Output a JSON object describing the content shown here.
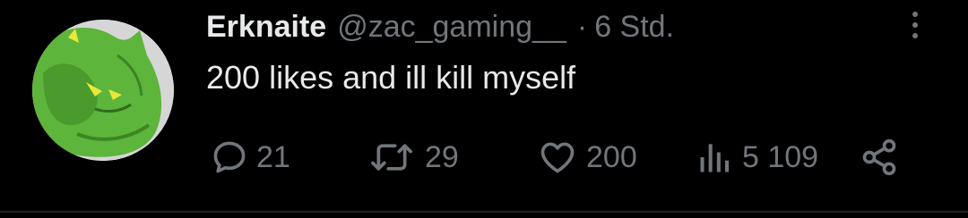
{
  "tweet": {
    "display_name": "Erknaite",
    "handle": "@zac_gaming__",
    "separator": "·",
    "time": "6 Std.",
    "text": "200 likes and ill kill myself"
  },
  "actions": {
    "replies": "21",
    "retweets": "29",
    "likes": "200",
    "views": "5 109"
  },
  "icons": {
    "more": "more-dots-icon",
    "reply": "reply-bubble-icon",
    "retweet": "retweet-icon",
    "like": "heart-icon",
    "views": "views-bar-chart-icon",
    "share": "share-icon"
  },
  "colors": {
    "background": "#000000",
    "text_primary": "#e7e9ea",
    "text_secondary": "#71767b",
    "avatar_green": "#5cb83a"
  }
}
